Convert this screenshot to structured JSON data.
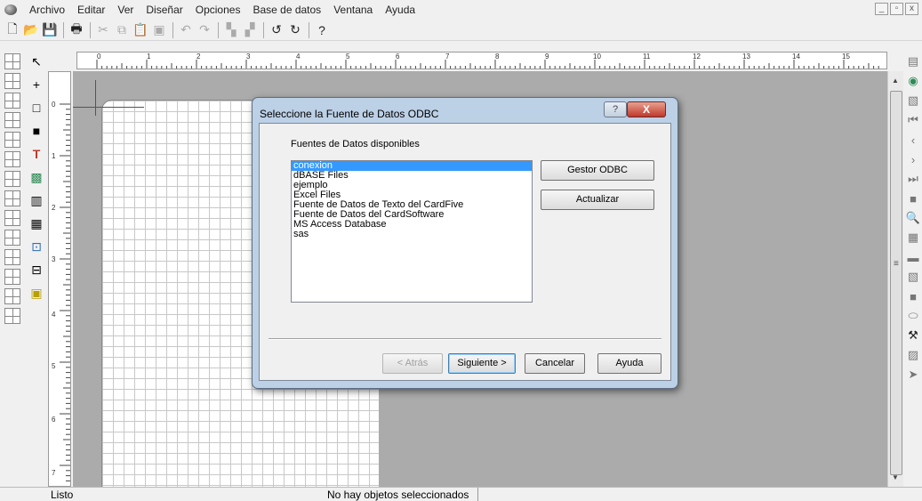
{
  "menu": {
    "items": [
      "Archivo",
      "Editar",
      "Ver",
      "Diseñar",
      "Opciones",
      "Base de datos",
      "Ventana",
      "Ayuda"
    ]
  },
  "window_controls": {
    "minimize": "_",
    "maximize": "▫",
    "close": "x"
  },
  "ruler": {
    "h_numbers": [
      "0",
      "1",
      "2",
      "3",
      "4",
      "5",
      "6",
      "7",
      "8",
      "9",
      "10",
      "11",
      "12",
      "13",
      "14",
      "15"
    ],
    "v_numbers": [
      "0",
      "1",
      "2",
      "3",
      "4",
      "5",
      "6",
      "7"
    ]
  },
  "dialog": {
    "title": "Seleccione la Fuente de Datos ODBC",
    "help_label": "?",
    "close_label": "X",
    "list_label": "Fuentes de Datos disponibles",
    "sources": [
      "conexion",
      "dBASE Files",
      "ejemplo",
      "Excel Files",
      "Fuente de Datos de Texto del CardFive",
      "Fuente de Datos del CardSoftware",
      "MS Access Database",
      "sas"
    ],
    "selected_index": 0,
    "gestor_label": "Gestor ODBC",
    "actualizar_label": "Actualizar",
    "back_label": "< Atrás",
    "next_label": "Siguiente >",
    "cancel_label": "Cancelar",
    "help_button_label": "Ayuda"
  },
  "status": {
    "left": "Listo",
    "middle": "No hay objetos seleccionados"
  },
  "scrollbar": {
    "grip": "≡"
  }
}
